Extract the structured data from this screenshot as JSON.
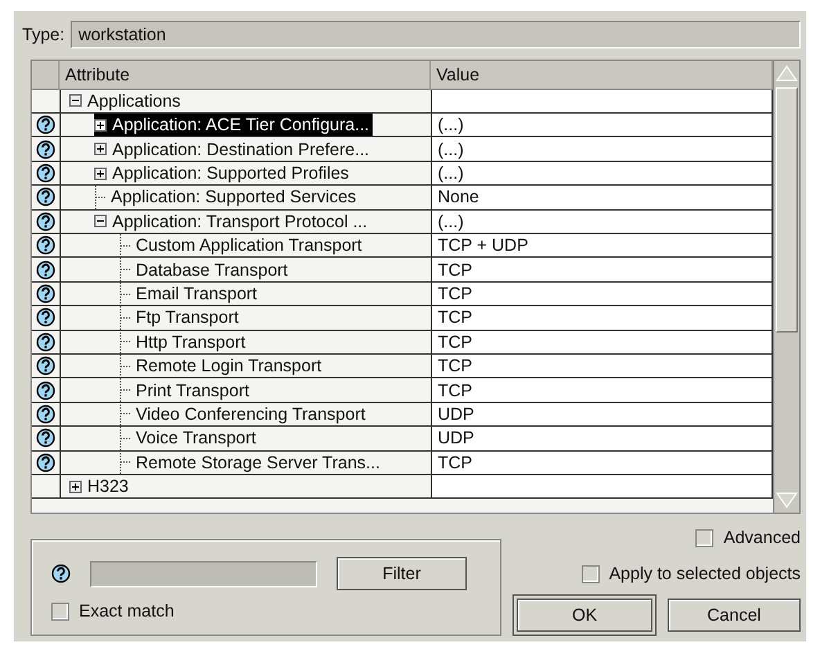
{
  "type_field": {
    "label": "Type:",
    "value": "workstation"
  },
  "table": {
    "columns": [
      "Attribute",
      "Value"
    ],
    "rows": [
      {
        "kind": "group",
        "label": "Applications",
        "help": false,
        "expanded": true,
        "selected": false,
        "children": [
          {
            "kind": "group",
            "label": "Application: ACE Tier Configura...",
            "value": "(...)",
            "help": true,
            "expanded": false,
            "selected": true
          },
          {
            "kind": "group",
            "label": "Application: Destination Prefere...",
            "value": "(...)",
            "help": true,
            "expanded": false,
            "selected": false
          },
          {
            "kind": "group",
            "label": "Application: Supported Profiles",
            "value": "(...)",
            "help": true,
            "expanded": false,
            "selected": false
          },
          {
            "kind": "leaf",
            "label": "Application: Supported Services",
            "value": "None",
            "help": true,
            "selected": false
          },
          {
            "kind": "group",
            "label": "Application: Transport Protocol ...",
            "value": "(...)",
            "help": true,
            "expanded": true,
            "selected": false,
            "children": [
              {
                "kind": "leaf",
                "label": "Custom Application Transport",
                "value": "TCP + UDP",
                "help": true,
                "selected": false
              },
              {
                "kind": "leaf",
                "label": "Database Transport",
                "value": "TCP",
                "help": true,
                "selected": false
              },
              {
                "kind": "leaf",
                "label": "Email Transport",
                "value": "TCP",
                "help": true,
                "selected": false
              },
              {
                "kind": "leaf",
                "label": "Ftp Transport",
                "value": "TCP",
                "help": true,
                "selected": false
              },
              {
                "kind": "leaf",
                "label": "Http Transport",
                "value": "TCP",
                "help": true,
                "selected": false
              },
              {
                "kind": "leaf",
                "label": "Remote Login Transport",
                "value": "TCP",
                "help": true,
                "selected": false
              },
              {
                "kind": "leaf",
                "label": "Print Transport",
                "value": "TCP",
                "help": true,
                "selected": false
              },
              {
                "kind": "leaf",
                "label": "Video Conferencing Transport",
                "value": "UDP",
                "help": true,
                "selected": false
              },
              {
                "kind": "leaf",
                "label": "Voice Transport",
                "value": "UDP",
                "help": true,
                "selected": false
              },
              {
                "kind": "leaf",
                "label": "Remote Storage Server Trans...",
                "value": "TCP",
                "help": true,
                "selected": false
              }
            ]
          }
        ]
      },
      {
        "kind": "group",
        "label": "H323",
        "help": false,
        "expanded": false,
        "selected": false
      }
    ]
  },
  "filter": {
    "button": "Filter",
    "exact_match": {
      "label": "Exact match",
      "checked": false
    }
  },
  "options": [
    {
      "label": "Advanced",
      "checked": false
    },
    {
      "label": "Apply to selected objects",
      "checked": false
    }
  ],
  "buttons": [
    {
      "label": "OK",
      "default": true
    },
    {
      "label": "Cancel",
      "default": false
    }
  ]
}
